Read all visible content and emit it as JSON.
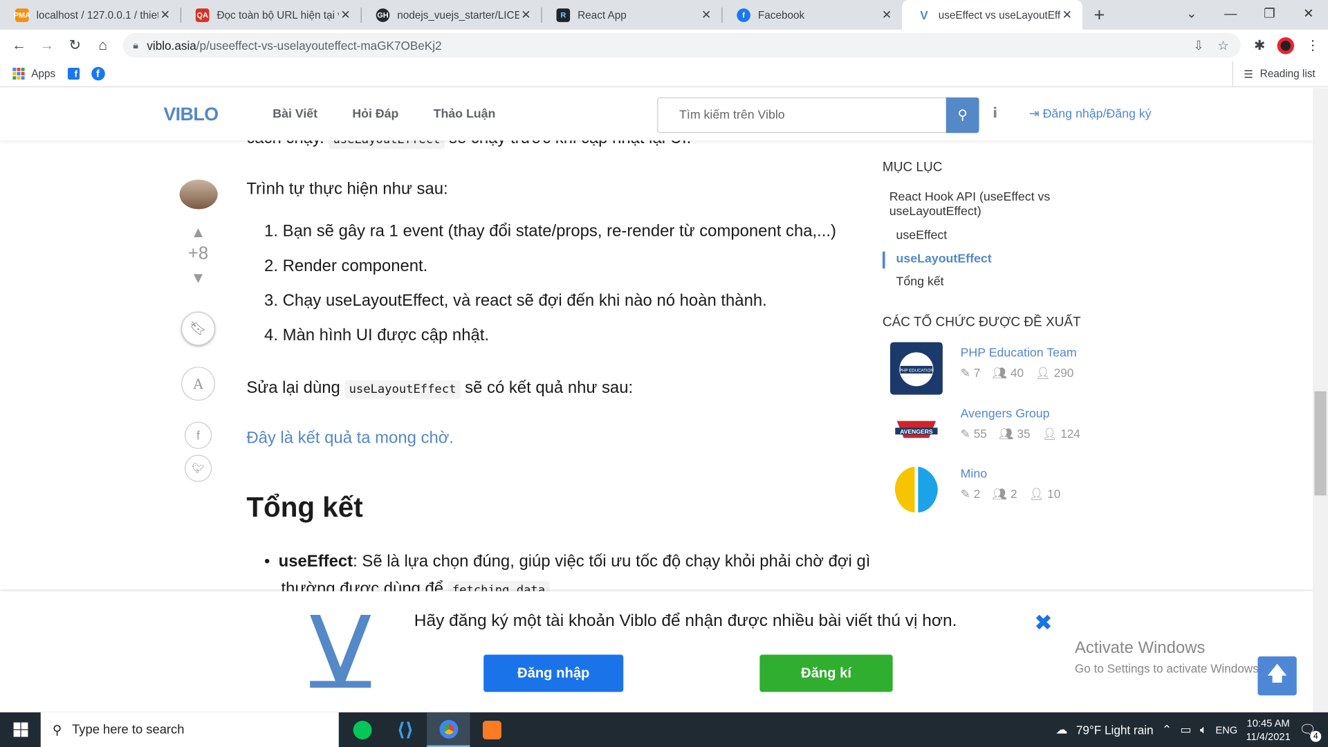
{
  "browser": {
    "tabs": [
      {
        "title": "localhost / 127.0.0.1 / thietb",
        "favicon_color": "#f29111",
        "favicon_text": "PMA"
      },
      {
        "title": "Đọc toàn bộ URL hiện tại vớ",
        "favicon_color": "#d93025",
        "favicon_text": "QA"
      },
      {
        "title": "nodejs_vuejs_starter/LICENS",
        "favicon_color": "#24292e",
        "favicon_text": "GH"
      },
      {
        "title": "React App",
        "favicon_color": "#20232a",
        "favicon_text": "R"
      },
      {
        "title": "Facebook",
        "favicon_color": "#1877f2",
        "favicon_text": "f"
      },
      {
        "title": "useEffect vs useLayoutEffec",
        "favicon_color": "#5488c7",
        "favicon_text": "V",
        "active": true
      }
    ],
    "url_host": "viblo.asia",
    "url_path": "/p/useeffect-vs-uselayouteffect-maGK7OBeKj2",
    "bookmarks": [
      {
        "label": "Apps"
      }
    ],
    "reading_list": "Reading list"
  },
  "site": {
    "logo": "VIBLO",
    "nav": [
      "Bài Viết",
      "Hỏi Đáp",
      "Thảo Luận"
    ],
    "search_placeholder": "Tìm kiếm trên Viblo",
    "login": "Đăng nhập/Đăng ký"
  },
  "article": {
    "cut_top": "cách chạy.",
    "cut_top_code": "useLayoutEffect",
    "cut_top_rest": "sẽ chạy trước khi cập nhật lại UI.",
    "intro": "Trình tự thực hiện như sau:",
    "steps": [
      "1. Bạn sẽ gây ra 1 event (thay đổi state/props, re-render từ component cha,...)",
      "2. Render component.",
      "3. Chạy useLayoutEffect, và react sẽ đợi đến khi nào nó hoàn thành.",
      "4. Màn hình UI được cập nhật."
    ],
    "fix_pre": "Sửa lại dùng",
    "fix_code": "useLayoutEffect",
    "fix_post": "sẽ có kết quả như sau:",
    "result_link": "Đây là kết quả ta mong chờ.",
    "summary_heading": "Tổng kết",
    "bullet_bold": "useEffect",
    "bullet_text": ": Sẽ là lựa chọn đúng, giúp việc tối ưu tốc độ chạy khỏi phải chờ đợi gì",
    "bullet_cut": "thường được dùng để",
    "bullet_cut_code": "fetching data"
  },
  "rail": {
    "score": "+8",
    "font_btn": "A"
  },
  "toc": {
    "heading": "MỤC LỤC",
    "items": [
      {
        "label": "React Hook API (useEffect vs useLayoutEffect)",
        "level": 1
      },
      {
        "label": "useEffect",
        "level": 2
      },
      {
        "label": "useLayoutEffect",
        "level": 2,
        "active": true
      },
      {
        "label": "Tổng kết",
        "level": 2
      }
    ]
  },
  "orgs": {
    "heading": "CÁC TỔ CHỨC ĐƯỢC ĐỀ XUẤT",
    "items": [
      {
        "name": "PHP Education Team",
        "posts": "7",
        "members": "40",
        "followers": "290",
        "logo_text": "PHP EDUCATION"
      },
      {
        "name": "Avengers Group",
        "posts": "55",
        "members": "35",
        "followers": "124",
        "logo_text": "AVENGERS"
      },
      {
        "name": "Mino",
        "posts": "2",
        "members": "2",
        "followers": "10"
      }
    ]
  },
  "banner": {
    "message": "Hãy đăng ký một tài khoản Viblo để nhận được nhiều bài viết thú vị hơn.",
    "login_btn": "Đăng nhập",
    "register_btn": "Đăng kí"
  },
  "watermark": {
    "line1": "Activate Windows",
    "line2": "Go to Settings to activate Windows."
  },
  "taskbar": {
    "search_placeholder": "Type here to search",
    "weather": "79°F  Light rain",
    "lang": "ENG",
    "time": "10:45 AM",
    "date": "11/4/2021",
    "notifications": "4"
  }
}
